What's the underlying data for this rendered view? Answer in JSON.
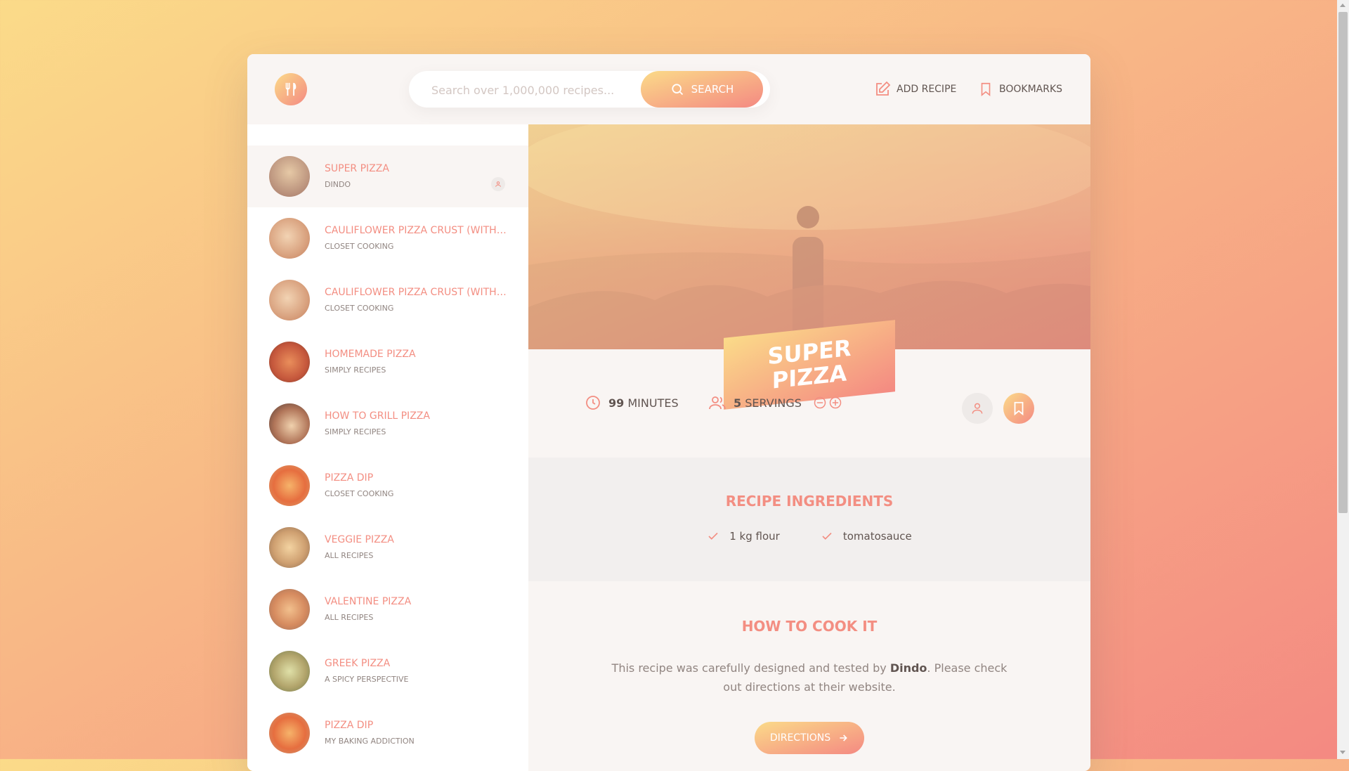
{
  "header": {
    "logo_icon": "fork-knife-icon",
    "search_placeholder": "Search over 1,000,000 recipes...",
    "search_value": "",
    "search_label": "Search",
    "add_recipe_label": "Add recipe",
    "bookmarks_label": "Bookmarks"
  },
  "results": [
    {
      "title": "Super Pizza",
      "publisher": "Dindo",
      "active": true,
      "user_generated": true
    },
    {
      "title": "Cauliflower Pizza Crust (with BBQ Chicken Pizza)",
      "publisher": "Closet Cooking"
    },
    {
      "title": "Cauliflower Pizza Crust (with BBQ Chicken Pizza)",
      "publisher": "Closet Cooking"
    },
    {
      "title": "Homemade Pizza",
      "publisher": "Simply Recipes"
    },
    {
      "title": "How to Grill Pizza",
      "publisher": "Simply Recipes"
    },
    {
      "title": "Pizza Dip",
      "publisher": "Closet Cooking"
    },
    {
      "title": "Veggie Pizza",
      "publisher": "All Recipes"
    },
    {
      "title": "Valentine Pizza",
      "publisher": "All Recipes"
    },
    {
      "title": "Greek Pizza",
      "publisher": "A Spicy Perspective"
    },
    {
      "title": "Pizza Dip",
      "publisher": "My Baking Addiction"
    }
  ],
  "recipe": {
    "title": "Super Pizza",
    "cooking_time": "99",
    "cooking_time_unit": "minutes",
    "servings": "5",
    "servings_unit": "servings",
    "ingredients_heading": "Recipe ingredients",
    "ingredients": [
      "1 kg flour",
      "tomatosauce"
    ],
    "directions_heading": "How to cook it",
    "directions_text_1": "This recipe was carefully designed and tested by ",
    "publisher": "Dindo",
    "directions_text_2": ". Please check out directions at their website.",
    "directions_button": "Directions"
  },
  "colors": {
    "accent": "#f38e82",
    "gradient_start": "#fbdb89",
    "gradient_end": "#f48982",
    "text": "#615551"
  }
}
